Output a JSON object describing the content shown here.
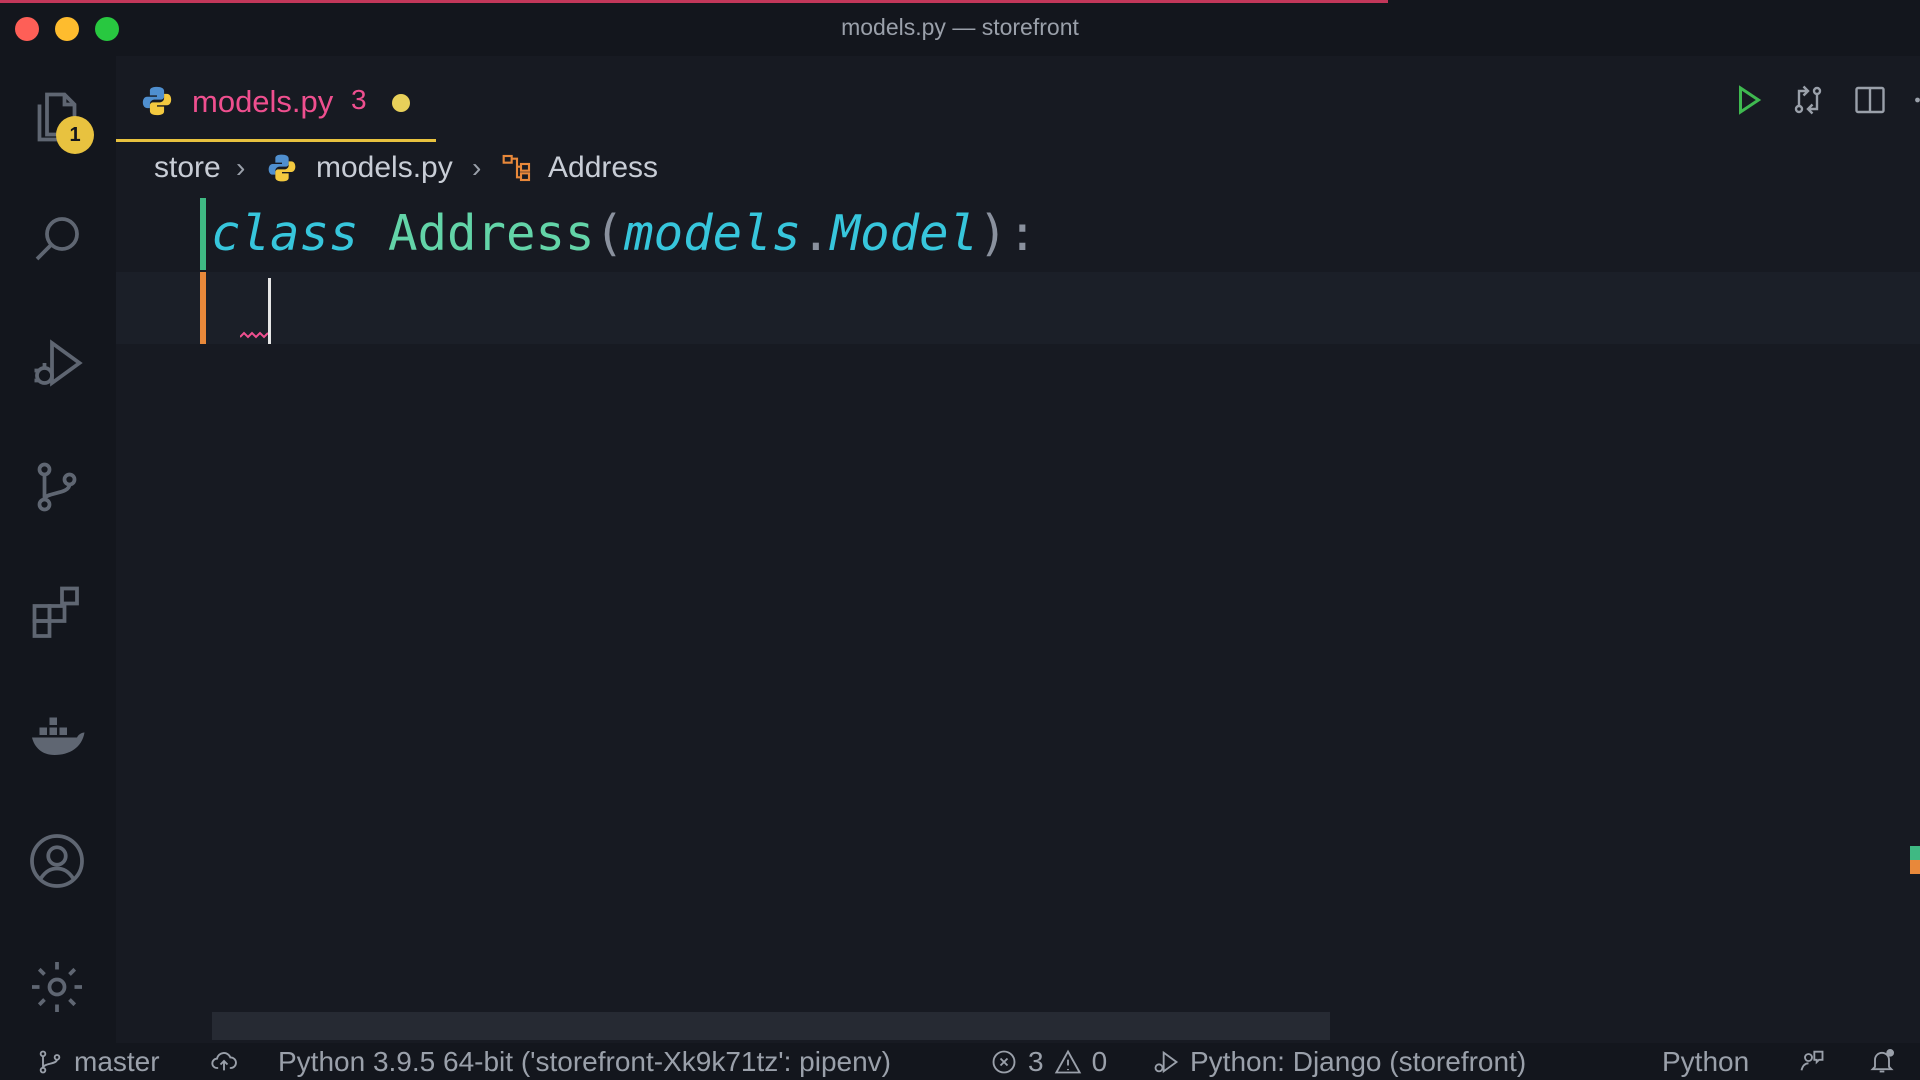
{
  "window": {
    "title": "models.py — storefront"
  },
  "activity_bar": {
    "explorer_badge": "1",
    "items": [
      "explorer",
      "search",
      "run-and-debug",
      "source-control",
      "extensions",
      "docker",
      "accounts",
      "manage"
    ]
  },
  "tab": {
    "name": "models.py",
    "problem_count": "3",
    "unsaved": true
  },
  "breadcrumb": {
    "folder": "store",
    "file": "models.py",
    "symbol": "Address"
  },
  "code": {
    "line1": {
      "keyword": "class",
      "class_name": "Address",
      "open_paren": "(",
      "module": "models",
      "dot": ".",
      "base": "Model",
      "close_paren": ")",
      "colon": ":"
    }
  },
  "status_bar": {
    "branch": "master",
    "interpreter": "Python 3.9.5 64-bit ('storefront-Xk9k71tz': pipenv)",
    "errors": "3",
    "warnings": "0",
    "debug_config": "Python: Django (storefront)",
    "language": "Python"
  },
  "colors": {
    "accent": "#e8c23f",
    "tab_text": "#ef4f8f",
    "keyword": "#37c6dc",
    "class_name": "#63d4a8",
    "run": "#3fb950"
  }
}
